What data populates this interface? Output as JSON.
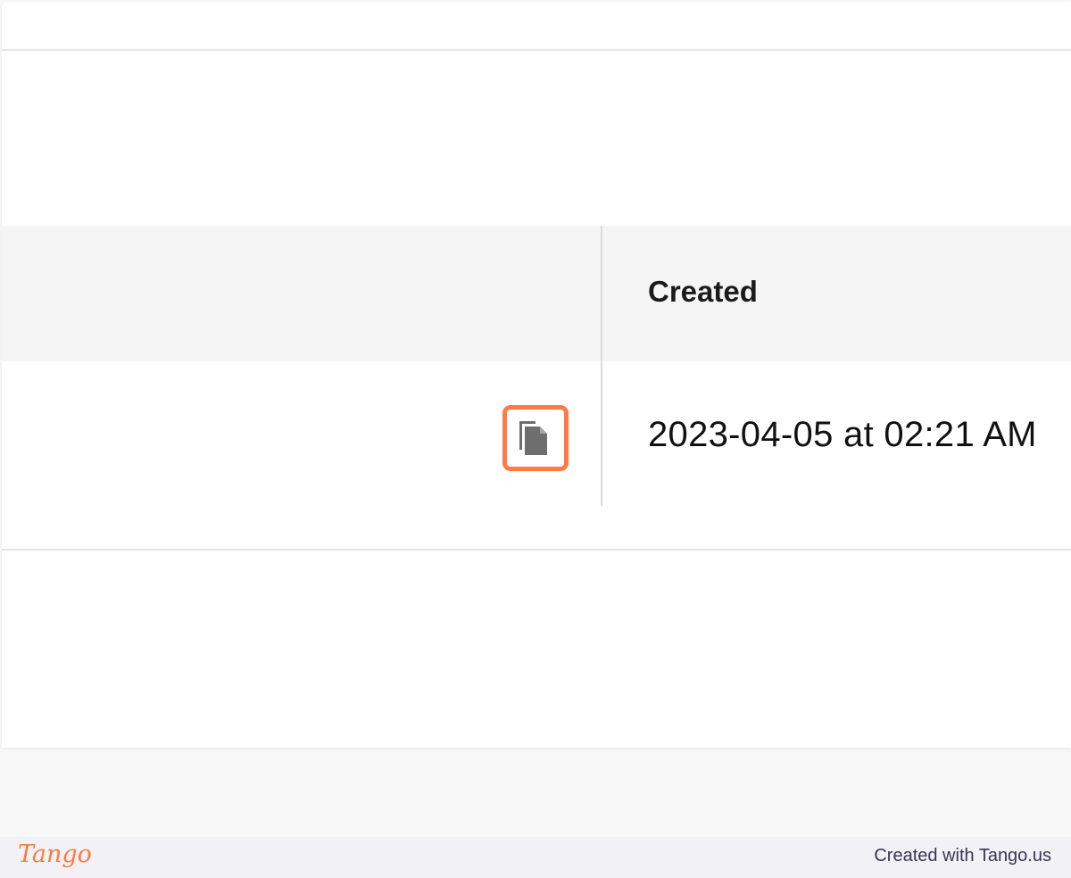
{
  "table": {
    "column_header": "Created",
    "row": {
      "created_value": "2023-04-05 at 02:21 AM"
    }
  },
  "icons": {
    "copy": "copy-icon"
  },
  "highlight": {
    "color": "#ff7a45"
  },
  "footer": {
    "logo_text": "Tango",
    "credit": "Created with Tango.us"
  }
}
